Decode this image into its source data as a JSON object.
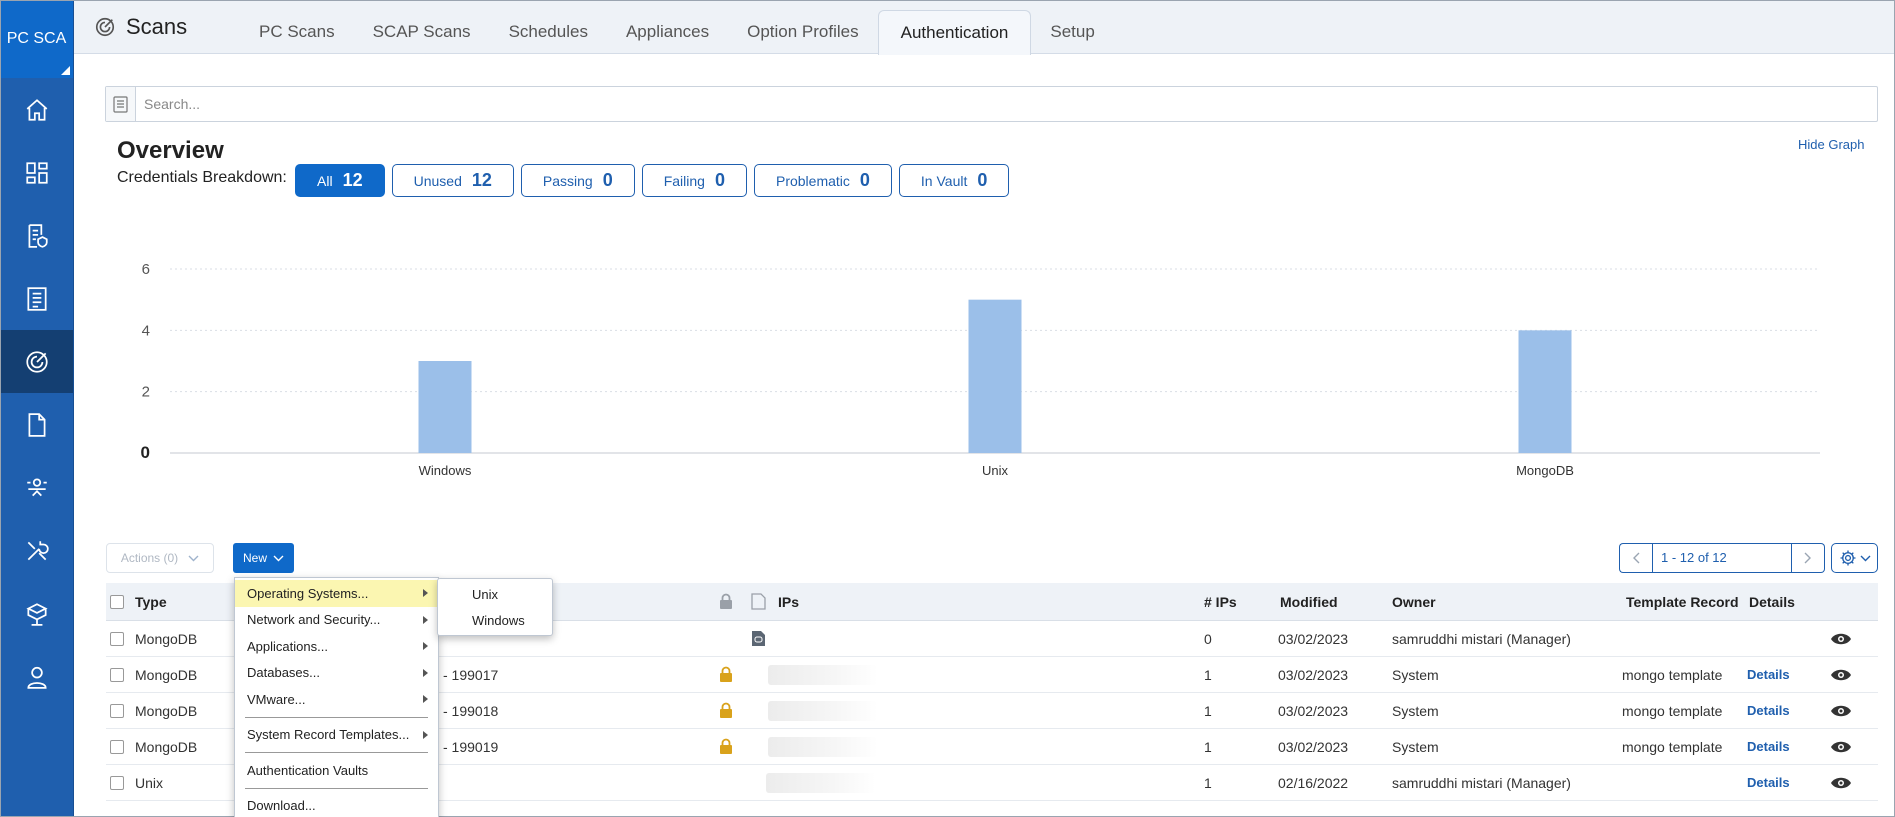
{
  "brand": "PC SCA",
  "app_title": "Scans",
  "tabs": [
    {
      "label": "PC Scans"
    },
    {
      "label": "SCAP Scans"
    },
    {
      "label": "Schedules"
    },
    {
      "label": "Appliances"
    },
    {
      "label": "Option Profiles"
    },
    {
      "label": "Authentication",
      "active": true
    },
    {
      "label": "Setup"
    }
  ],
  "rail_icons": [
    "home-icon",
    "dashboard-icon",
    "policies-icon",
    "reports-icon",
    "scans-icon",
    "document-icon",
    "workflow-icon",
    "tools-icon",
    "assets-icon",
    "user-icon"
  ],
  "search": {
    "placeholder": "Search..."
  },
  "overview": {
    "title": "Overview",
    "breakdown_label": "Credentials Breakdown:",
    "hide_graph": "Hide Graph",
    "chips": [
      {
        "label": "All",
        "count": "12",
        "active": true
      },
      {
        "label": "Unused",
        "count": "12"
      },
      {
        "label": "Passing",
        "count": "0"
      },
      {
        "label": "Failing",
        "count": "0"
      },
      {
        "label": "Problematic",
        "count": "0"
      },
      {
        "label": "In Vault",
        "count": "0"
      }
    ]
  },
  "chart_data": {
    "type": "bar",
    "categories": [
      "Windows",
      "Unix",
      "MongoDB"
    ],
    "values": [
      3,
      5,
      4
    ],
    "ylim": [
      0,
      6
    ],
    "yticks": [
      "0",
      "2",
      "4",
      "6"
    ],
    "grid": true,
    "bar_color": "#9bbfe9"
  },
  "toolbar": {
    "actions_label": "Actions (0)",
    "new_label": "New",
    "pager_range": "1 - 12 of 12"
  },
  "table": {
    "headers": {
      "type": "Type",
      "ips": "IPs",
      "num_ips": "# IPs",
      "modified": "Modified",
      "owner": "Owner",
      "template_record": "Template Record",
      "details": "Details"
    },
    "rows": [
      {
        "type": "MongoDB",
        "title": "",
        "num_ips": "0",
        "modified": "03/02/2023",
        "owner": "samruddhi mistari (Manager)",
        "template_record": "",
        "details": "",
        "locked": false,
        "doc": true
      },
      {
        "type": "MongoDB",
        "title": "- 199017",
        "num_ips": "1",
        "modified": "03/02/2023",
        "owner": "System",
        "template_record": "mongo template",
        "details": "Details",
        "locked": true,
        "doc": false
      },
      {
        "type": "MongoDB",
        "title": "- 199018",
        "num_ips": "1",
        "modified": "03/02/2023",
        "owner": "System",
        "template_record": "mongo template",
        "details": "Details",
        "locked": true,
        "doc": false
      },
      {
        "type": "MongoDB",
        "title": "- 199019",
        "num_ips": "1",
        "modified": "03/02/2023",
        "owner": "System",
        "template_record": "mongo template",
        "details": "Details",
        "locked": true,
        "doc": false
      },
      {
        "type": "Unix",
        "title": "",
        "num_ips": "1",
        "modified": "02/16/2022",
        "owner": "samruddhi mistari (Manager)",
        "template_record": "",
        "details": "Details",
        "locked": false,
        "doc": false
      }
    ]
  },
  "new_menu": {
    "items": [
      {
        "label": "Operating Systems...",
        "submenu": true,
        "highlighted": true
      },
      {
        "label": "Network and Security...",
        "submenu": true
      },
      {
        "label": "Applications...",
        "submenu": true
      },
      {
        "label": "Databases...",
        "submenu": true
      },
      {
        "label": "VMware...",
        "submenu": true
      },
      {
        "label": "System Record Templates...",
        "submenu": true
      },
      {
        "label": "Authentication Vaults",
        "submenu": false
      },
      {
        "label": "Download...",
        "submenu": false
      }
    ],
    "submenu_items": [
      {
        "label": "Unix"
      },
      {
        "label": "Windows"
      }
    ]
  }
}
